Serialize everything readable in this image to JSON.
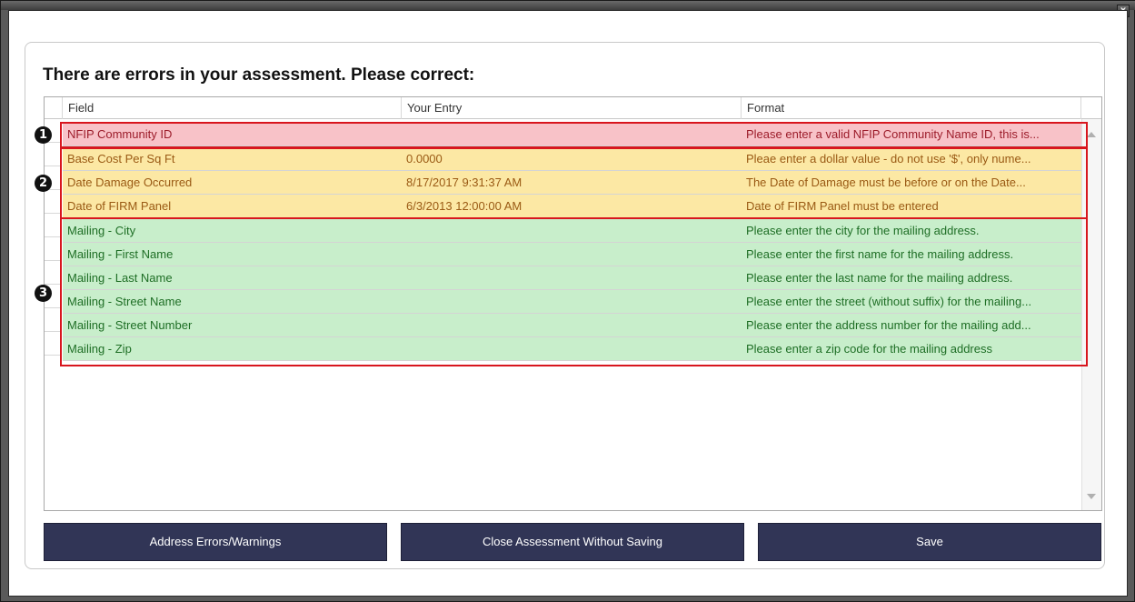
{
  "window": {
    "close_glyph": "x"
  },
  "heading": "There are errors in your assessment. Please correct:",
  "columns": [
    "Field",
    "Your Entry",
    "Format"
  ],
  "rows": [
    {
      "status": "error",
      "field": "NFIP Community ID",
      "entry": "",
      "format": "Please enter a valid NFIP Community Name ID, this is..."
    },
    {
      "status": "warning",
      "field": "Base Cost Per Sq Ft",
      "entry": "0.0000",
      "format": "Pleae enter a dollar value - do not use '$', only nume..."
    },
    {
      "status": "warning",
      "field": "Date Damage Occurred",
      "entry": "8/17/2017 9:31:37 AM",
      "format": "The Date of Damage must be before or on the Date..."
    },
    {
      "status": "warning",
      "field": "Date of FIRM Panel",
      "entry": "6/3/2013 12:00:00 AM",
      "format": "Date of FIRM Panel must be entered"
    },
    {
      "status": "ok",
      "field": "Mailing - City",
      "entry": "",
      "format": "Please enter the city for the mailing address."
    },
    {
      "status": "ok",
      "field": "Mailing - First Name",
      "entry": "",
      "format": "Please enter the first name for the mailing address."
    },
    {
      "status": "ok",
      "field": "Mailing - Last Name",
      "entry": "",
      "format": "Please enter the last name for the mailing address."
    },
    {
      "status": "ok",
      "field": "Mailing - Street Name",
      "entry": "",
      "format": "Please enter the street (without suffix) for the mailing..."
    },
    {
      "status": "ok",
      "field": "Mailing - Street Number",
      "entry": "",
      "format": "Please enter the address number for the mailing add..."
    },
    {
      "status": "ok",
      "field": "Mailing - Zip",
      "entry": "",
      "format": "Please enter a zip code for the mailing address"
    }
  ],
  "markers": [
    "1",
    "2",
    "3"
  ],
  "buttons": {
    "address": "Address Errors/Warnings",
    "close": "Close Assessment Without Saving",
    "save": "Save"
  },
  "colors": {
    "error_row": "#f8c2c8",
    "warning_row": "#fce8a4",
    "ok_row": "#c8eecb",
    "highlight_border": "#d8161e",
    "button_bg": "#313556"
  }
}
